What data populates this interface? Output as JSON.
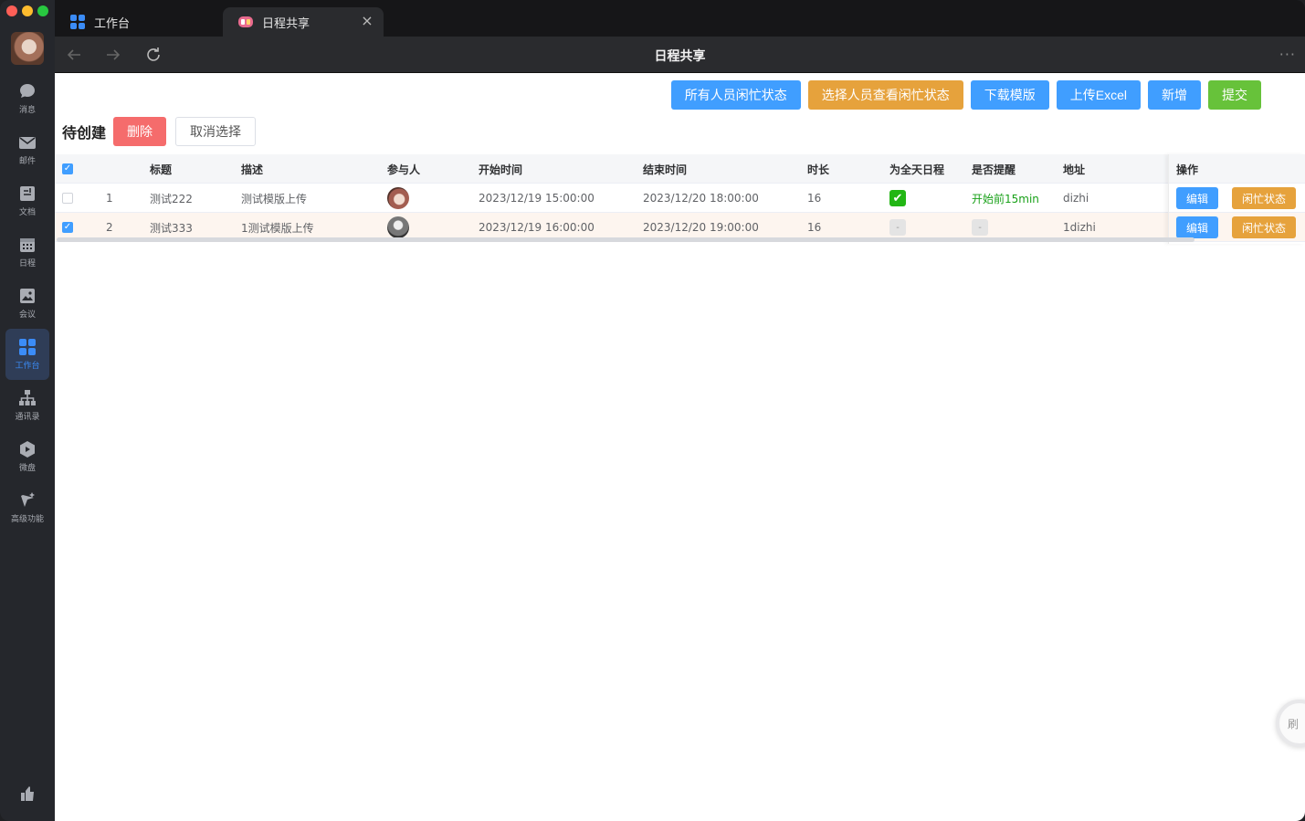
{
  "tabs": [
    {
      "label": "工作台",
      "icon": "grid-icon"
    },
    {
      "label": "日程共享",
      "icon": "app-logo-icon"
    }
  ],
  "navbar": {
    "title": "日程共享"
  },
  "sidebar": {
    "items": [
      {
        "label": "消息",
        "icon": "chat-icon"
      },
      {
        "label": "邮件",
        "icon": "mail-icon"
      },
      {
        "label": "文档",
        "icon": "document-icon"
      },
      {
        "label": "日程",
        "icon": "calendar-icon"
      },
      {
        "label": "会议",
        "icon": "meeting-icon"
      },
      {
        "label": "工作台",
        "icon": "grid-icon",
        "active": true
      },
      {
        "label": "通讯录",
        "icon": "org-chart-icon"
      },
      {
        "label": "微盘",
        "icon": "cloud-drive-icon"
      },
      {
        "label": "高级功能",
        "icon": "sparkle-icon"
      }
    ]
  },
  "toolbar": {
    "all_busy": "所有人员闲忙状态",
    "select_busy": "选择人员查看闲忙状态",
    "download_template": "下载模版",
    "upload_excel": "上传Excel",
    "add": "新增",
    "submit": "提交"
  },
  "section": {
    "title": "待创建",
    "delete": "删除",
    "cancel_select": "取消选择"
  },
  "table": {
    "headers": {
      "title": "标题",
      "desc": "描述",
      "participants": "参与人",
      "start": "开始时间",
      "end": "结束时间",
      "duration": "时长",
      "allday": "为全天日程",
      "remind": "是否提醒",
      "address": "地址",
      "ops": "操作"
    },
    "rows": [
      {
        "index": "1",
        "title": "测试222",
        "desc": "测试模版上传",
        "start": "2023/12/19 15:00:00",
        "end": "2023/12/20 18:00:00",
        "duration": "16",
        "allday": true,
        "remind": "开始前15min",
        "address": "dizhi",
        "selected": false
      },
      {
        "index": "2",
        "title": "测试333",
        "desc": "1测试模版上传",
        "start": "2023/12/19 16:00:00",
        "end": "2023/12/20 19:00:00",
        "duration": "16",
        "allday": false,
        "allday_text": "-",
        "remind": "-",
        "address": "1dizhi",
        "selected": true
      }
    ],
    "op_edit": "编辑",
    "op_busy": "闲忙状态"
  },
  "float_button": "刷",
  "colors": {
    "primary": "#409eff",
    "warning": "#e6a23c",
    "success": "#67c23a",
    "danger": "#f56c6c"
  }
}
